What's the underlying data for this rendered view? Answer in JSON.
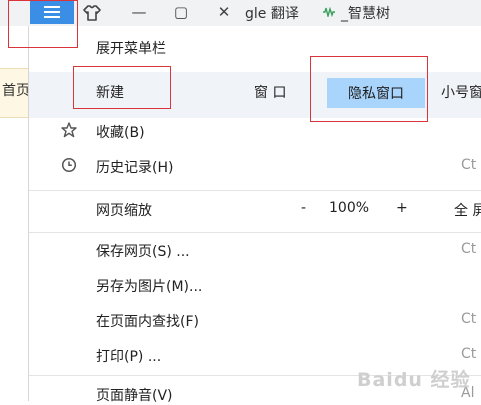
{
  "browser": {
    "tab_text_google": "gle 翻译",
    "tab_text_zhihuishu": "_智慧树",
    "left_band_text": "首页",
    "win_min": "—",
    "win_max": "▢",
    "win_close": "✕"
  },
  "menu": {
    "expand_menubar": "展开菜单栏",
    "new_label": "新建",
    "window": "窗 口",
    "private_window": "隐私窗口",
    "small_window": "小号窗",
    "favorites": "收藏(B)",
    "history": "历史记录(H)",
    "history_shortcut": "Ct",
    "zoom_label": "网页缩放",
    "zoom_minus": "-",
    "zoom_value": "100%",
    "zoom_plus": "+",
    "fullscreen": "全 屏",
    "save_page": "保存网页(S) ...",
    "save_shortcut": "Ct",
    "save_as_image": "另存为图片(M)...",
    "find_in_page": "在页面内查找(F)",
    "find_shortcut": "Ct",
    "print": "打印(P) ...",
    "print_shortcut": "Ct",
    "mute_page": "页面静音(V)",
    "mute_shortcut": "Al"
  },
  "watermark": "Baidu 经验",
  "colors": {
    "menu_button": "#3b8ee6",
    "private_highlight": "#a9d4fb",
    "annotation_red": "#d9333b"
  },
  "icons": [
    "hamburger-menu-icon",
    "shirt-skin-icon",
    "star-icon",
    "clock-icon",
    "waveform-icon"
  ]
}
